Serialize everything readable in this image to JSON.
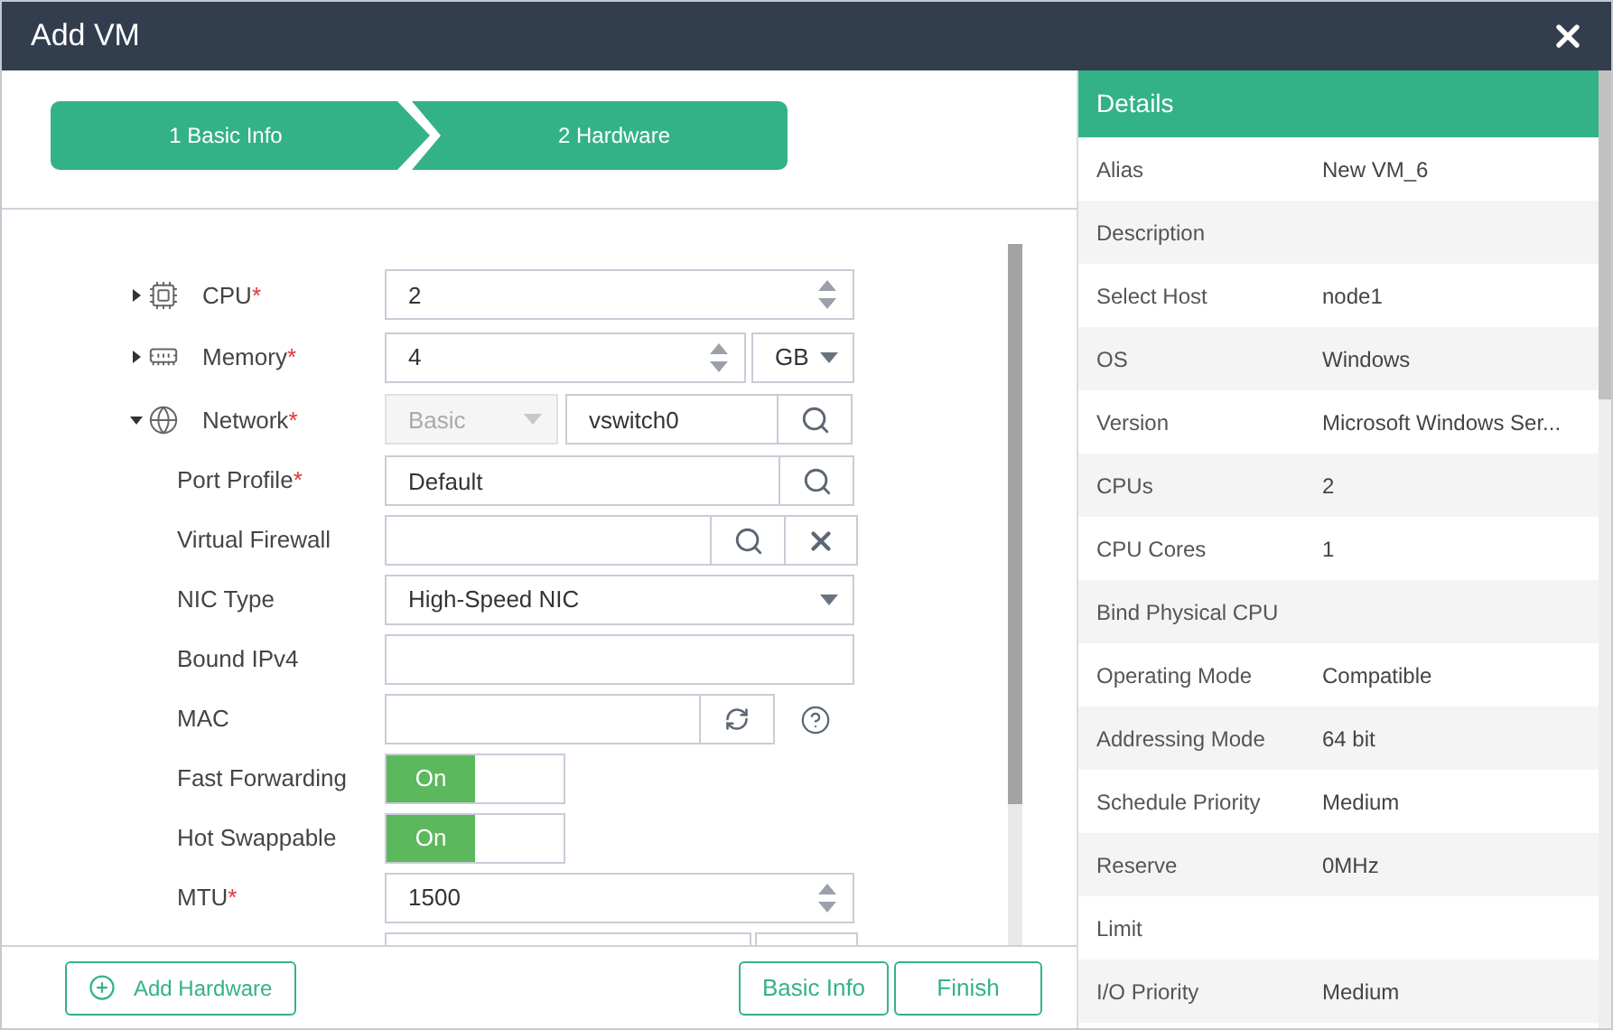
{
  "window": {
    "title": "Add VM"
  },
  "steps": [
    {
      "label": "1 Basic Info"
    },
    {
      "label": "2 Hardware"
    }
  ],
  "hardware": [
    {
      "label": "CPU",
      "required_mark": "*",
      "expanded": false,
      "field": {
        "kind": "spinner",
        "value": "2"
      }
    },
    {
      "label": "Memory",
      "required_mark": "*",
      "expanded": false,
      "field": {
        "kind": "spinner_unit",
        "value": "4",
        "unit": "GB"
      }
    },
    {
      "label": "Network",
      "required_mark": "*",
      "expanded": true,
      "field": {
        "kind": "network",
        "mode": "Basic",
        "mode_disabled": true,
        "value": "vswitch0"
      },
      "children": [
        {
          "label": "Port Profile",
          "required_mark": "*",
          "field": {
            "kind": "search",
            "value": "Default"
          }
        },
        {
          "label": "Virtual Firewall",
          "field": {
            "kind": "search_clear"
          }
        },
        {
          "label": "NIC Type",
          "field": {
            "kind": "select",
            "value": "High-Speed NIC"
          }
        },
        {
          "label": "Bound IPv4",
          "field": {
            "kind": "text"
          }
        },
        {
          "label": "MAC",
          "field": {
            "kind": "refresh_help"
          }
        },
        {
          "label": "Fast Forwarding",
          "field": {
            "kind": "toggle",
            "on": true,
            "text": "On"
          }
        },
        {
          "label": "Hot Swappable",
          "field": {
            "kind": "toggle",
            "on": true,
            "text": "On"
          }
        },
        {
          "label": "MTU",
          "required_mark": "*",
          "field": {
            "kind": "spinner",
            "value": "1500"
          }
        },
        {
          "field": {
            "kind": "cut_off"
          }
        }
      ]
    }
  ],
  "buttons": {
    "add_hardware": "Add Hardware",
    "back": "Basic Info",
    "finish": "Finish"
  },
  "details": {
    "title": "Details",
    "rows": [
      {
        "label": "Alias",
        "value": "New VM_6"
      },
      {
        "label": "Description"
      },
      {
        "label": "Select Host",
        "value": "node1"
      },
      {
        "label": "OS",
        "value": "Windows"
      },
      {
        "label": "Version",
        "value": "Microsoft Windows Ser..."
      },
      {
        "label": "CPUs",
        "value": "2"
      },
      {
        "label": "CPU Cores",
        "value": "1"
      },
      {
        "label": "Bind Physical CPU"
      },
      {
        "label": "Operating Mode",
        "value": "Compatible"
      },
      {
        "label": "Addressing Mode",
        "value": "64 bit"
      },
      {
        "label": "Schedule Priority",
        "value": "Medium"
      },
      {
        "label": "Reserve",
        "value": "0MHz"
      },
      {
        "label": "Limit"
      },
      {
        "label": "I/O Priority",
        "value": "Medium"
      }
    ]
  }
}
